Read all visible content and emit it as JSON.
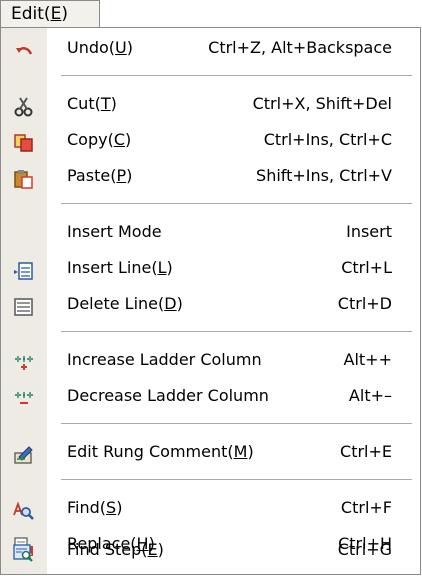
{
  "menubar": {
    "tab_text": "Edit(",
    "tab_mnemonic": "E",
    "tab_close": ")"
  },
  "items": {
    "undo": {
      "pre": "Undo(",
      "mn": "U",
      "post": ")",
      "shortcut": "Ctrl+Z, Alt+Backspace",
      "icon": "undo-icon"
    },
    "cut": {
      "pre": "Cut(",
      "mn": "T",
      "post": ")",
      "shortcut": "Ctrl+X, Shift+Del",
      "icon": "scissors-icon"
    },
    "copy": {
      "pre": "Copy(",
      "mn": "C",
      "post": ")",
      "shortcut": "Ctrl+Ins, Ctrl+C",
      "icon": "copy-icon"
    },
    "paste": {
      "pre": "Paste(",
      "mn": "P",
      "post": ")",
      "shortcut": "Shift+Ins, Ctrl+V",
      "icon": "paste-icon"
    },
    "insert_mode": {
      "label": "Insert Mode",
      "shortcut": "Insert"
    },
    "insert_line": {
      "pre": "Insert Line(",
      "mn": "L",
      "post": ")",
      "shortcut": "Ctrl+L",
      "icon": "insert-line-icon"
    },
    "delete_line": {
      "pre": "Delete Line(",
      "mn": "D",
      "post": ")",
      "shortcut": "Ctrl+D",
      "icon": "delete-line-icon"
    },
    "inc_col": {
      "label": "Increase Ladder Column",
      "shortcut": "Alt++",
      "icon": "increase-column-icon"
    },
    "dec_col": {
      "label": "Decrease Ladder Column",
      "shortcut": "Alt+–",
      "icon": "decrease-column-icon"
    },
    "edit_rung": {
      "pre": "Edit Rung Comment(",
      "mn": "M",
      "post": ")",
      "shortcut": "Ctrl+E",
      "icon": "edit-comment-icon"
    },
    "find": {
      "pre": "Find(",
      "mn": "S",
      "post": ")",
      "shortcut": "Ctrl+F",
      "icon": "find-icon"
    },
    "replace": {
      "pre": "Replace(",
      "mn": "H",
      "post": ")",
      "shortcut": "Ctrl+H",
      "icon": "replace-icon"
    },
    "find_step": {
      "pre": "Find Step(",
      "mn": "E",
      "post": ")",
      "shortcut": "Ctrl+G",
      "icon": "find-step-icon"
    }
  }
}
